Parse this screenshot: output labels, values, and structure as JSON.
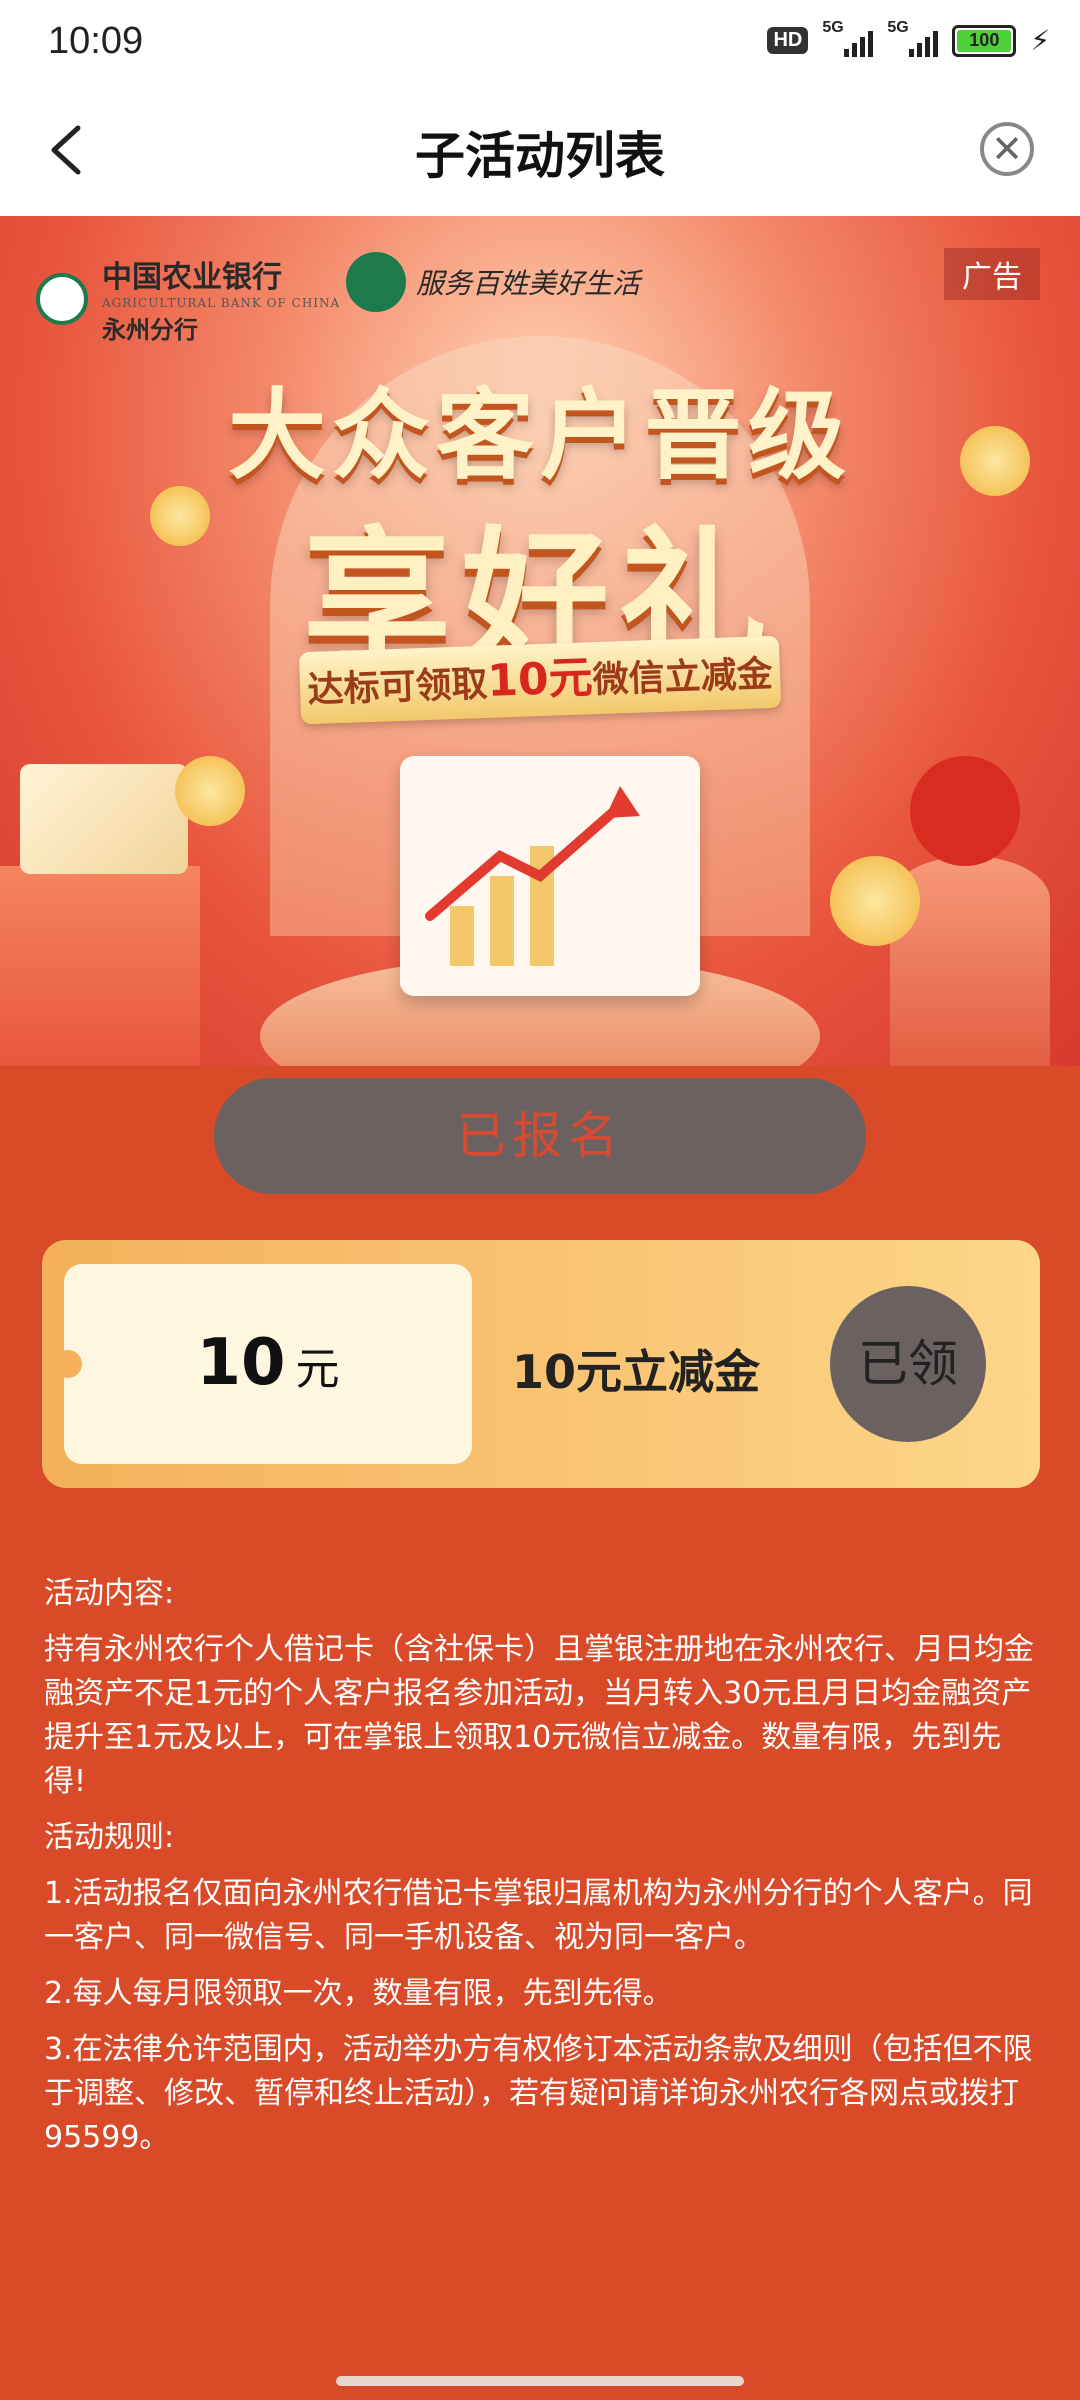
{
  "status_bar": {
    "time": "10:09",
    "hd": "HD",
    "net1": "5G",
    "net2": "5G",
    "battery": "100"
  },
  "nav": {
    "title": "子活动列表"
  },
  "banner": {
    "bank_name": "中国农业银行",
    "bank_name_en": "AGRICULTURAL BANK OF CHINA",
    "branch": "永州分行",
    "service_slogan": "服务百姓美好生活",
    "ad_label": "广告",
    "headline1": "大众客户晋级",
    "headline2": "享好礼",
    "ribbon_prefix": "达标可领取",
    "ribbon_amount": "10元",
    "ribbon_suffix": "微信立减金"
  },
  "signup_button": {
    "label": "已报名"
  },
  "coupon": {
    "amount": "10",
    "unit": "元",
    "name": "10元立减金",
    "status": "已领"
  },
  "description": {
    "content_title": "活动内容:",
    "content_text": "持有永州农行个人借记卡（含社保卡）且掌银注册地在永州农行、月日均金融资产不足1元的个人客户报名参加活动，当月转入30元且月日均金融资产提升至1元及以上，可在掌银上领取10元微信立减金。数量有限，先到先得!",
    "rules_title": "活动规则:",
    "rule1": "1.活动报名仅面向永州农行借记卡掌银归属机构为永州分行的个人客户。同一客户、同一微信号、同一手机设备、视为同一客户。",
    "rule2": "2.每人每月限领取一次，数量有限，先到先得。",
    "rule3": "3.在法律允许范围内，活动举办方有权修订本活动条款及细则（包括但不限于调整、修改、暂停和终止活动），若有疑问请详询永州农行各网点或拨打95599。"
  }
}
